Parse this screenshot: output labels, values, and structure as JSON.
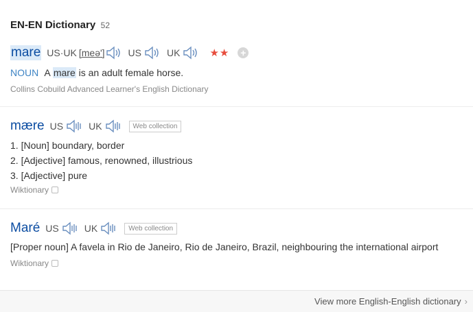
{
  "header": {
    "title": "EN-EN Dictionary",
    "count": "52"
  },
  "entries": [
    {
      "word": "mare",
      "pron_us_uk_label": "US·UK",
      "pron_ipa": "[meə']",
      "us_label": "US",
      "uk_label": "UK",
      "stars": "★★",
      "pos": "NOUN",
      "def_pre": "A",
      "def_word": "mare",
      "def_post": "is an adult female horse.",
      "source": "Collins Cobuild Advanced Learner's English Dictionary"
    },
    {
      "word": "mære",
      "us_label": "US",
      "uk_label": "UK",
      "badge": "Web collection",
      "senses": [
        "1. [Noun] boundary, border",
        "2. [Adjective] famous, renowned, illustrious",
        "3. [Adjective] pure"
      ],
      "source": "Wiktionary"
    },
    {
      "word": "Maré",
      "us_label": "US",
      "uk_label": "UK",
      "badge": "Web collection",
      "definition": "[Proper noun] A favela in Rio de Janeiro, Rio de Janeiro, Brazil, neighbouring the international airport",
      "source": "Wiktionary"
    }
  ],
  "footer": {
    "more_label": "View more English-English dictionary",
    "chevron": "›"
  },
  "icons": {
    "speaker": "speaker-icon",
    "add": "plus-icon",
    "checkbox": "checkbox-icon",
    "chevron": "chevron-right-icon"
  },
  "colors": {
    "word": "#0c4da2",
    "stars": "#e74c3c",
    "pos": "#3e84c4",
    "highlight": "#dbeaf8"
  }
}
